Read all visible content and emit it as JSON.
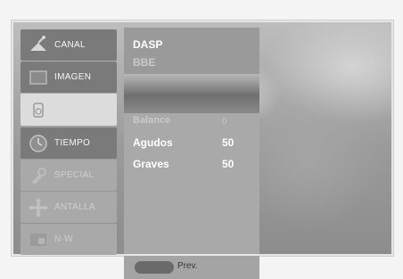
{
  "sidebar": {
    "items": [
      {
        "label": "CANAL",
        "icon": "antenna-icon"
      },
      {
        "label": "IMAGEN",
        "icon": "picture-icon"
      },
      {
        "label": "",
        "icon": "speaker-icon"
      },
      {
        "label": "TIEMPO",
        "icon": "clock-icon"
      },
      {
        "label": "SPECIAL",
        "icon": "wrench-icon"
      },
      {
        "label": "ANTALLA",
        "icon": "screen-adjust-icon"
      },
      {
        "label": "N·W",
        "icon": "pip-icon"
      }
    ]
  },
  "menu": {
    "items": [
      {
        "label": "DASP",
        "value": ""
      },
      {
        "label": "BBE",
        "value": ""
      },
      {
        "label": "Balance",
        "value": "0"
      },
      {
        "label": "Agudos",
        "value": "50"
      },
      {
        "label": "Graves",
        "value": "50"
      }
    ]
  },
  "footer": {
    "prev_label": "Prev."
  }
}
